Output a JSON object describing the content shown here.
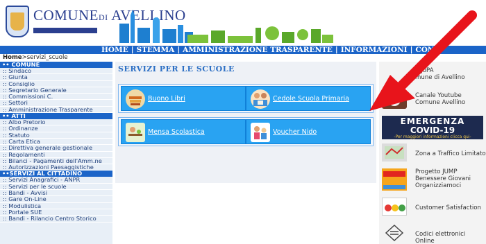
{
  "header": {
    "brand_prefix": "COMUNE",
    "brand_di": "DI",
    "brand_city": "AVELLINO"
  },
  "nav": {
    "items": [
      "HOME",
      "STEMMA",
      "AMMINISTRAZIONE TRASPARENTE",
      "INFORMAZIONI",
      "CONT"
    ]
  },
  "breadcrumb": {
    "home": "Home",
    "current": ">servizi_scuole"
  },
  "leftmenu": {
    "sections": [
      {
        "title": "•• COMUNE",
        "items": [
          ":: Sindaco",
          ":: Giunta",
          ":: Consiglio",
          ":: Segretario Generale",
          ":: Commissioni C.",
          ":: Settori",
          ":: Amministrazione Trasparente"
        ]
      },
      {
        "title": "•• ATTI",
        "items": [
          ":: Albo Pretorio",
          ":: Ordinanze",
          ":: Statuto",
          ":: Carta Etica",
          ":: Direttiva generale gestionale",
          ":: Regolamenti",
          ":: Bilanci - Pagamenti dell'Amm.ne",
          ":: Autorizzazioni Paesaggistiche"
        ]
      },
      {
        "title": "••SERVIZI AL CITTADINO",
        "items": [
          ":: Servizi Anagrafici - ANPR",
          ":: Servizi per le scuole",
          ":: Bandi - Avvisi",
          ":: Gare On-Line",
          ":: Modulistica",
          ":: Portale SUE",
          ":: Bandi - Rilancio Centro Storico"
        ]
      }
    ]
  },
  "main": {
    "title": "SERVIZI PER LE SCUOLE",
    "buttons": [
      {
        "label": "Buono Libri",
        "icon": "books-icon"
      },
      {
        "label": "Cedole Scuola Primaria",
        "icon": "children-reading-icon"
      },
      {
        "label": "Mensa Scolastica",
        "icon": "school-canteen-icon"
      },
      {
        "label": "Voucher Nido",
        "icon": "nursery-kids-icon"
      }
    ]
  },
  "rightcol": {
    "pagopa_line1": "agoPA",
    "pagopa_line2": "mune di Avellino",
    "youtube_line1": "Canale Youtube",
    "youtube_line2": "Comune Avellino",
    "covid_line1": "EMERGENZA",
    "covid_line2": "COVID-19",
    "covid_line3": "-Per maggiori informazioni clicca qui-",
    "ztl": "Zona a Traffico Limitato",
    "jump_line1": "Progetto JUMP",
    "jump_line2": "Benessere Giovani",
    "jump_line3": "Organizziamoci",
    "customer": "Customer Satisfaction",
    "codici": "Codici elettronici Online"
  },
  "colors": {
    "nav_blue": "#1b64c8",
    "button_blue": "#29a3f2",
    "arrow_red": "#e8141b",
    "title_blue": "#2c6fc4"
  }
}
